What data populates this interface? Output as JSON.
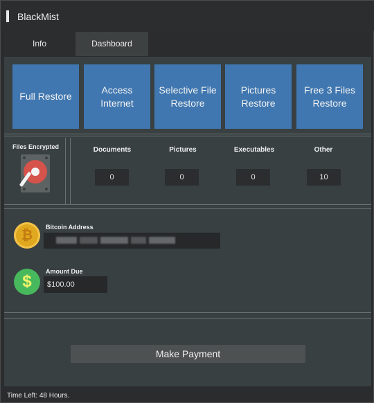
{
  "window": {
    "title": "BlackMist"
  },
  "tabs": [
    {
      "label": "Info",
      "active": false
    },
    {
      "label": "Dashboard",
      "active": true
    }
  ],
  "restore_buttons": [
    {
      "label": "Full Restore"
    },
    {
      "label": "Access Internet"
    },
    {
      "label": "Selective File Restore"
    },
    {
      "label": "Pictures Restore"
    },
    {
      "label": "Free 3 Files Restore"
    }
  ],
  "files_encrypted": {
    "label": "Files Encrypted",
    "icon": "hard-disk-icon",
    "columns": [
      {
        "label": "Documents",
        "count": "0"
      },
      {
        "label": "Pictures",
        "count": "0"
      },
      {
        "label": "Executables",
        "count": "0"
      },
      {
        "label": "Other",
        "count": "10"
      }
    ]
  },
  "payment": {
    "bitcoin_label": "Bitcoin Address",
    "bitcoin_icon": "bitcoin-icon",
    "amount_label": "Amount Due",
    "amount_icon": "dollar-icon",
    "amount_value": "$100.00",
    "pay_button": "Make Payment"
  },
  "status": {
    "text": "Time Left: 48 Hours."
  },
  "colors": {
    "accent_button": "#4077b0",
    "panel": "#384042",
    "background": "#2a2c2d"
  }
}
